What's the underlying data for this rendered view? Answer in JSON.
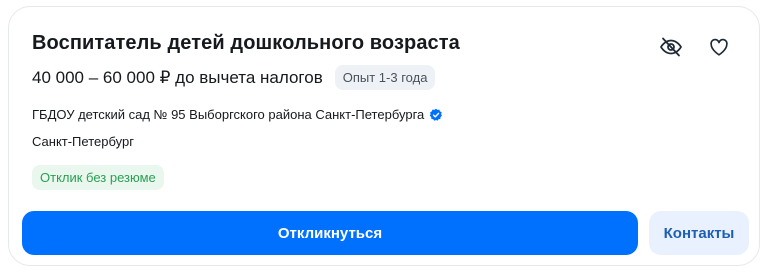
{
  "vacancy": {
    "title": "Воспитатель детей дошкольного возраста",
    "salary": "40 000 – 60 000 ₽ до вычета налогов",
    "experience": "Опыт 1-3 года",
    "company": "ГБДОУ детский сад № 95 Выборгского района Санкт-Петербурга",
    "company_verified": true,
    "city": "Санкт-Петербург",
    "no_resume_badge": "Отклик без резюме"
  },
  "actions": {
    "respond_label": "Откликнуться",
    "contacts_label": "Контакты"
  },
  "icons": {
    "hide": "eye-off-icon",
    "favorite": "heart-icon",
    "verified": "verified-check-icon"
  },
  "colors": {
    "primary": "#0070ff",
    "secondary_bg": "#e8f1fd",
    "secondary_text": "#1f5fb3",
    "success_bg": "#e9f7ee",
    "success_text": "#2c9f53",
    "badge_bg": "#eef1f5"
  }
}
